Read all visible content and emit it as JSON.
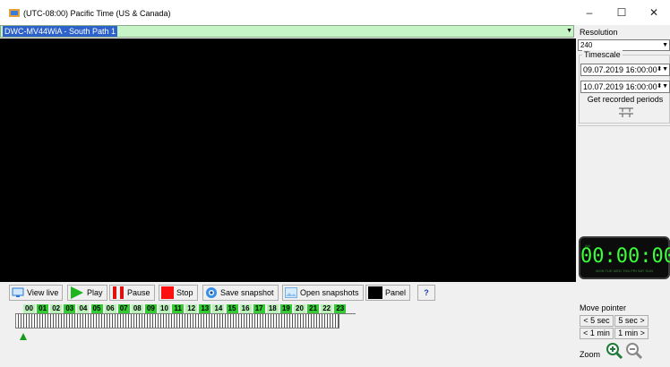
{
  "window": {
    "title": "(UTC-08:00) Pacific Time (US & Canada)",
    "minimize": "–",
    "maximize": "☐",
    "close": "✕"
  },
  "camera": {
    "selected": "DWC-MV44WiA - South Path 1"
  },
  "right_panel": {
    "resolution_label": "Resolution",
    "resolution_value": "240",
    "timescale_label": "Timescale",
    "start": "09.07.2019 16:00:00",
    "end": "10.07.2019 16:00:00",
    "get_periods": "Get recorded periods"
  },
  "clock": {
    "time": "00:00:00",
    "am": "AM",
    "days": "MON TUE WED THU FRI SAT SUN"
  },
  "toolbar": {
    "view_live": "View live",
    "play": "Play",
    "pause": "Pause",
    "stop": "Stop",
    "save_snapshot": "Save snapshot",
    "open_snapshots": "Open snapshots",
    "panel": "Panel",
    "help": "?"
  },
  "timeline": {
    "hours": [
      "00",
      "01",
      "02",
      "03",
      "04",
      "05",
      "06",
      "07",
      "08",
      "09",
      "10",
      "11",
      "12",
      "13",
      "14",
      "15",
      "16",
      "17",
      "18",
      "19",
      "20",
      "21",
      "22",
      "23"
    ],
    "highlight_colors": {
      "bright": "#33cc33",
      "light": "#b8f0b8"
    }
  },
  "move_pointer": {
    "label": "Move pointer",
    "back_5s": "< 5 sec",
    "fwd_5s": "5 sec >",
    "back_1m": "< 1 min",
    "fwd_1m": "1 min >",
    "zoom_label": "Zoom"
  }
}
